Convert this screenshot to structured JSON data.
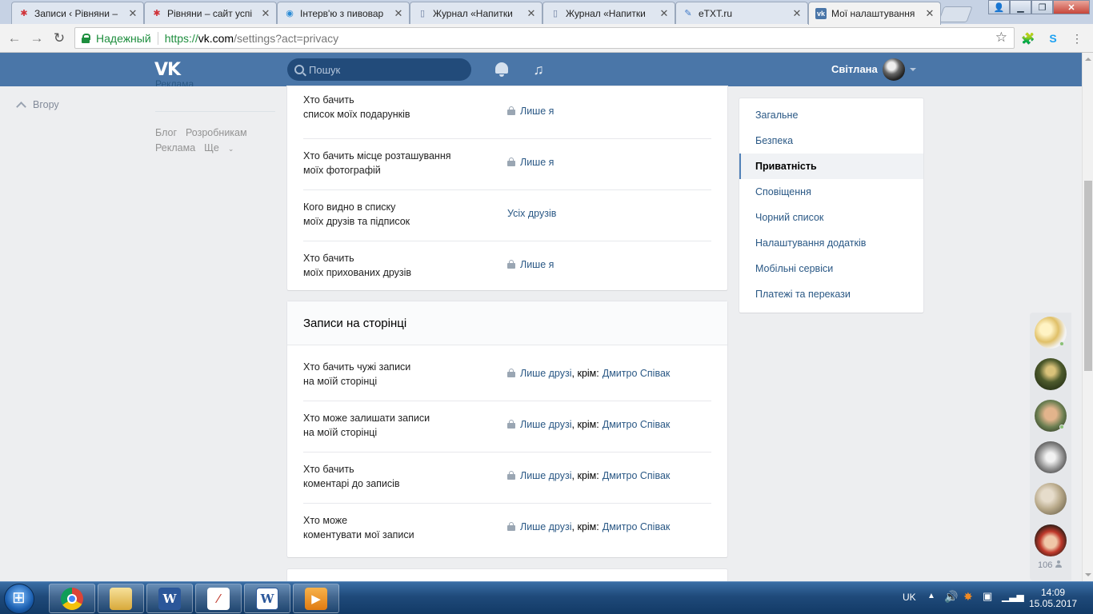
{
  "browser": {
    "tabs": [
      {
        "title": "Записи ‹ Рівняни –",
        "favicon_color": "#d0333a"
      },
      {
        "title": "Рівняни – сайт успі",
        "favicon_color": "#d0333a"
      },
      {
        "title": "Інтерв'ю з пивовар",
        "favicon_color": "#2a8bd6"
      },
      {
        "title": "Журнал «Напитки",
        "favicon_color": "#6b7da0"
      },
      {
        "title": "Журнал «Напитки",
        "favicon_color": "#6b7da0"
      },
      {
        "title": "eTXT.ru",
        "favicon_color": "#3d78c7"
      },
      {
        "title": "Мої налаштування",
        "favicon_color": "#4a76a8"
      }
    ],
    "secure_label": "Надежный",
    "url_proto": "https://",
    "url_host": "vk.com",
    "url_path": "/settings?act=privacy"
  },
  "vk_header": {
    "logo": "VK",
    "search_placeholder": "Пошук",
    "user_name": "Світлана"
  },
  "left": {
    "up_label": "Вгору",
    "ads_cut": "Реклама",
    "links": [
      "Блог",
      "Розробникам",
      "Реклама",
      "Ще"
    ]
  },
  "privacy_rows_top": [
    {
      "label1": "Хто бачить",
      "label2": "список моїх подарунків",
      "value": "Лише я",
      "locked": true
    },
    {
      "label1": "Хто бачить місце розташування",
      "label2": "моїх фотографій",
      "value": "Лише я",
      "locked": true
    },
    {
      "label1": "Кого видно в списку",
      "label2": "моїх друзів та підписок",
      "value": "Усіх друзів",
      "locked": false
    },
    {
      "label1": "Хто бачить",
      "label2": "моїх прихованих друзів",
      "value": "Лише я",
      "locked": true
    }
  ],
  "wall_section": {
    "title": "Записи на сторінці",
    "rows": [
      {
        "label1": "Хто бачить чужі записи",
        "label2": "на моїй сторінці",
        "value": "Лише друзі",
        "except_label": "крім:",
        "except_name": "Дмитро Співак"
      },
      {
        "label1": "Хто може залишати записи",
        "label2": "на моїй сторінці",
        "value": "Лише друзі",
        "except_label": "крім:",
        "except_name": "Дмитро Співак"
      },
      {
        "label1": "Хто бачить",
        "label2": "коментарі до записів",
        "value": "Лише друзі",
        "except_label": "крім:",
        "except_name": "Дмитро Співак"
      },
      {
        "label1": "Хто може",
        "label2": "коментувати мої записи",
        "value": "Лише друзі",
        "except_label": "крім:",
        "except_name": "Дмитро Співак"
      }
    ]
  },
  "settings_nav": [
    {
      "label": "Загальне",
      "selected": false
    },
    {
      "label": "Безпека",
      "selected": false
    },
    {
      "label": "Приватність",
      "selected": true
    },
    {
      "label": "Сповіщення",
      "selected": false
    },
    {
      "label": "Чорний список",
      "selected": false
    },
    {
      "label": "Налаштування додатків",
      "selected": false
    },
    {
      "label": "Мобільні сервіси",
      "selected": false
    },
    {
      "label": "Платежі та перекази",
      "selected": false
    }
  ],
  "friends_bar": {
    "count": "106"
  },
  "taskbar": {
    "lang": "UK",
    "time": "14:09",
    "date": "15.05.2017"
  },
  "colors": {
    "vk_blue": "#4a76a8",
    "link": "#2a5885",
    "page_bg": "#edeef0"
  }
}
